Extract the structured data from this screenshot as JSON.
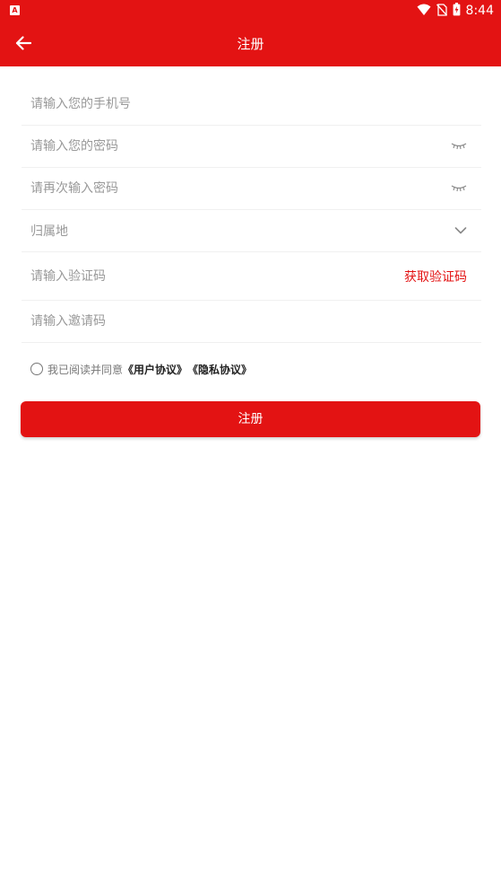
{
  "status_bar": {
    "app_icon_letter": "A",
    "time": "8:44",
    "icons": [
      "wifi-icon",
      "no-sim-icon",
      "battery-icon"
    ]
  },
  "app_bar": {
    "back_icon": "arrow-left-icon",
    "title": "注册"
  },
  "form": {
    "phone_placeholder": "请输入您的手机号",
    "password_placeholder": "请输入您的密码",
    "password_confirm_placeholder": "请再次输入密码",
    "region_label": "归属地",
    "code_placeholder": "请输入验证码",
    "get_code_label": "获取验证码",
    "invite_placeholder": "请输入邀请码"
  },
  "agreement": {
    "text": "我已阅读并同意",
    "user_agreement": "《用户协议》",
    "privacy_agreement": "《隐私协议》"
  },
  "submit": {
    "label": "注册"
  },
  "colors": {
    "primary": "#e31313",
    "placeholder": "#999999",
    "divider": "#f0f0f0"
  }
}
